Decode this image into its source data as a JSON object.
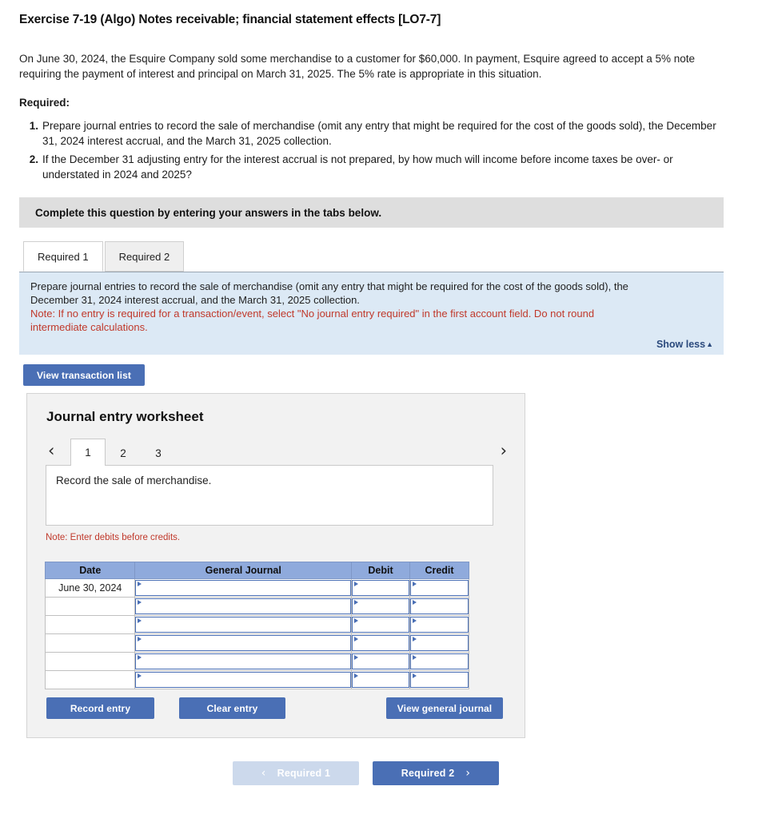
{
  "exercise": {
    "title": "Exercise 7-19 (Algo) Notes receivable; financial statement effects [LO7-7]",
    "problem": "On June 30, 2024, the Esquire Company sold some merchandise to a customer for $60,000. In payment, Esquire agreed to accept a 5% note requiring the payment of interest and principal on March 31, 2025. The 5% rate is appropriate in this situation.",
    "required_label": "Required:",
    "requirements": [
      {
        "num": "1.",
        "text": "Prepare journal entries to record the sale of merchandise (omit any entry that might be required for the cost of the goods sold), the December 31, 2024 interest accrual, and the March 31, 2025 collection."
      },
      {
        "num": "2.",
        "text": "If the December 31 adjusting entry for the interest accrual is not prepared, by how much will income before income taxes be over- or understated in 2024 and 2025?"
      }
    ]
  },
  "banner": {
    "text": "Complete this question by entering your answers in the tabs below."
  },
  "tabs": [
    {
      "label": "Required 1",
      "active": true
    },
    {
      "label": "Required 2",
      "active": false
    }
  ],
  "instructions": {
    "line1": "Prepare journal entries to record the sale of merchandise (omit any entry that might be required for the cost of the goods sold), the",
    "line2": "December 31, 2024 interest accrual, and the March 31, 2025 collection.",
    "note_line1": "Note: If no entry is required for a transaction/event, select \"No journal entry required\" in the first account field. Do not round",
    "note_line2": "intermediate calculations.",
    "show_less": "Show less",
    "show_less_caret": "▲"
  },
  "toolbar": {
    "view_transaction_list": "View transaction list"
  },
  "worksheet": {
    "title": "Journal entry worksheet",
    "pager": {
      "prev_icon": "‹",
      "next_icon": "›",
      "pages": [
        "1",
        "2",
        "3"
      ],
      "active_page": "1"
    },
    "description": "Record the sale of merchandise.",
    "note_debits": "Note: Enter debits before credits.",
    "table": {
      "headers": [
        "Date",
        "General Journal",
        "Debit",
        "Credit"
      ],
      "rows": [
        {
          "date": "June 30, 2024",
          "general_journal": "",
          "debit": "",
          "credit": ""
        },
        {
          "date": "",
          "general_journal": "",
          "debit": "",
          "credit": ""
        },
        {
          "date": "",
          "general_journal": "",
          "debit": "",
          "credit": ""
        },
        {
          "date": "",
          "general_journal": "",
          "debit": "",
          "credit": ""
        },
        {
          "date": "",
          "general_journal": "",
          "debit": "",
          "credit": ""
        },
        {
          "date": "",
          "general_journal": "",
          "debit": "",
          "credit": ""
        }
      ]
    },
    "buttons": {
      "record_entry": "Record entry",
      "clear_entry": "Clear entry",
      "view_general_journal": "View general journal"
    }
  },
  "navigation": {
    "prev_label": "Required 1",
    "prev_icon": "‹",
    "next_label": "Required 2",
    "next_icon": "›"
  },
  "colors": {
    "accent_blue": "#4a6fb5",
    "panel_blue": "#dce9f5",
    "banner_gray": "#dedede",
    "table_header_blue": "#8faadc",
    "note_red": "#c0392b",
    "disabled_blue": "#ccd9ec"
  }
}
